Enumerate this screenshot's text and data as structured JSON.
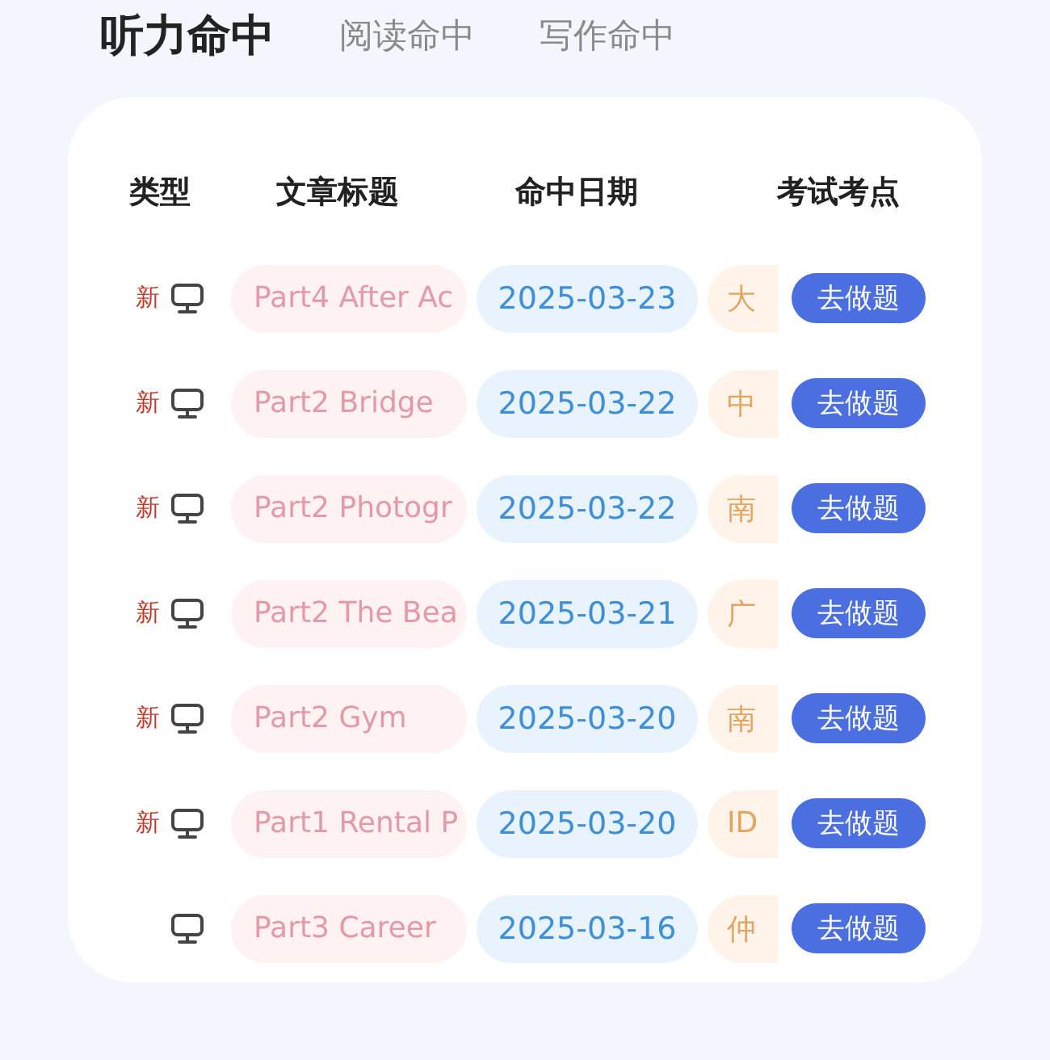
{
  "tabs": [
    {
      "label": "听力命中",
      "selected": true
    },
    {
      "label": "阅读命中",
      "selected": false
    },
    {
      "label": "写作命中",
      "selected": false
    }
  ],
  "table": {
    "columns": [
      "类型",
      "文章标题",
      "命中日期",
      "考试考点"
    ],
    "rows": [
      {
        "badge": "新",
        "title": "Part4 After Ac",
        "date": "2025-03-23",
        "exam": "大",
        "action": "去做题"
      },
      {
        "badge": "新",
        "title": "Part2 Bridge",
        "date": "2025-03-22",
        "exam": "中",
        "action": "去做题"
      },
      {
        "badge": "新",
        "title": "Part2 Photogr",
        "date": "2025-03-22",
        "exam": "南",
        "action": "去做题"
      },
      {
        "badge": "新",
        "title": "Part2 The Bea",
        "date": "2025-03-21",
        "exam": "广",
        "action": "去做题"
      },
      {
        "badge": "新",
        "title": "Part2 Gym",
        "date": "2025-03-20",
        "exam": "南",
        "action": "去做题"
      },
      {
        "badge": "新",
        "title": "Part1 Rental P",
        "date": "2025-03-20",
        "exam": "ID",
        "action": "去做题"
      },
      {
        "title": "Part3 Career",
        "date": "2025-03-16",
        "exam": "仲",
        "action": "去做题"
      }
    ]
  }
}
